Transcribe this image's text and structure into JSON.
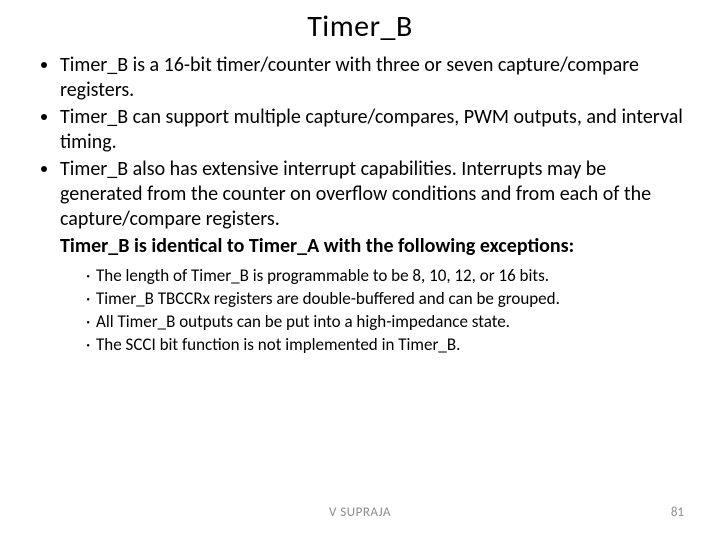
{
  "title": "Timer_B",
  "bullets": [
    "Timer_B is a 16-bit timer/counter with three or seven capture/compare registers.",
    "Timer_B can support  multiple capture/compares, PWM outputs, and interval timing.",
    "Timer_B also has extensive interrupt capabilities. Interrupts may be generated from the counter on overflow conditions and from each of the capture/compare registers."
  ],
  "bold_line": "Timer_B is identical to Timer_A with the following exceptions:",
  "sub_bullets": [
    "The length of Timer_B is programmable to be 8, 10, 12, or 16 bits.",
    "Timer_B TBCCRx registers are double-buffered and can be grouped.",
    "All Timer_B outputs can be put into a high-impedance state.",
    "The SCCI bit function is not implemented in Timer_B."
  ],
  "footer_author": "V SUPRAJA",
  "footer_page": "81"
}
